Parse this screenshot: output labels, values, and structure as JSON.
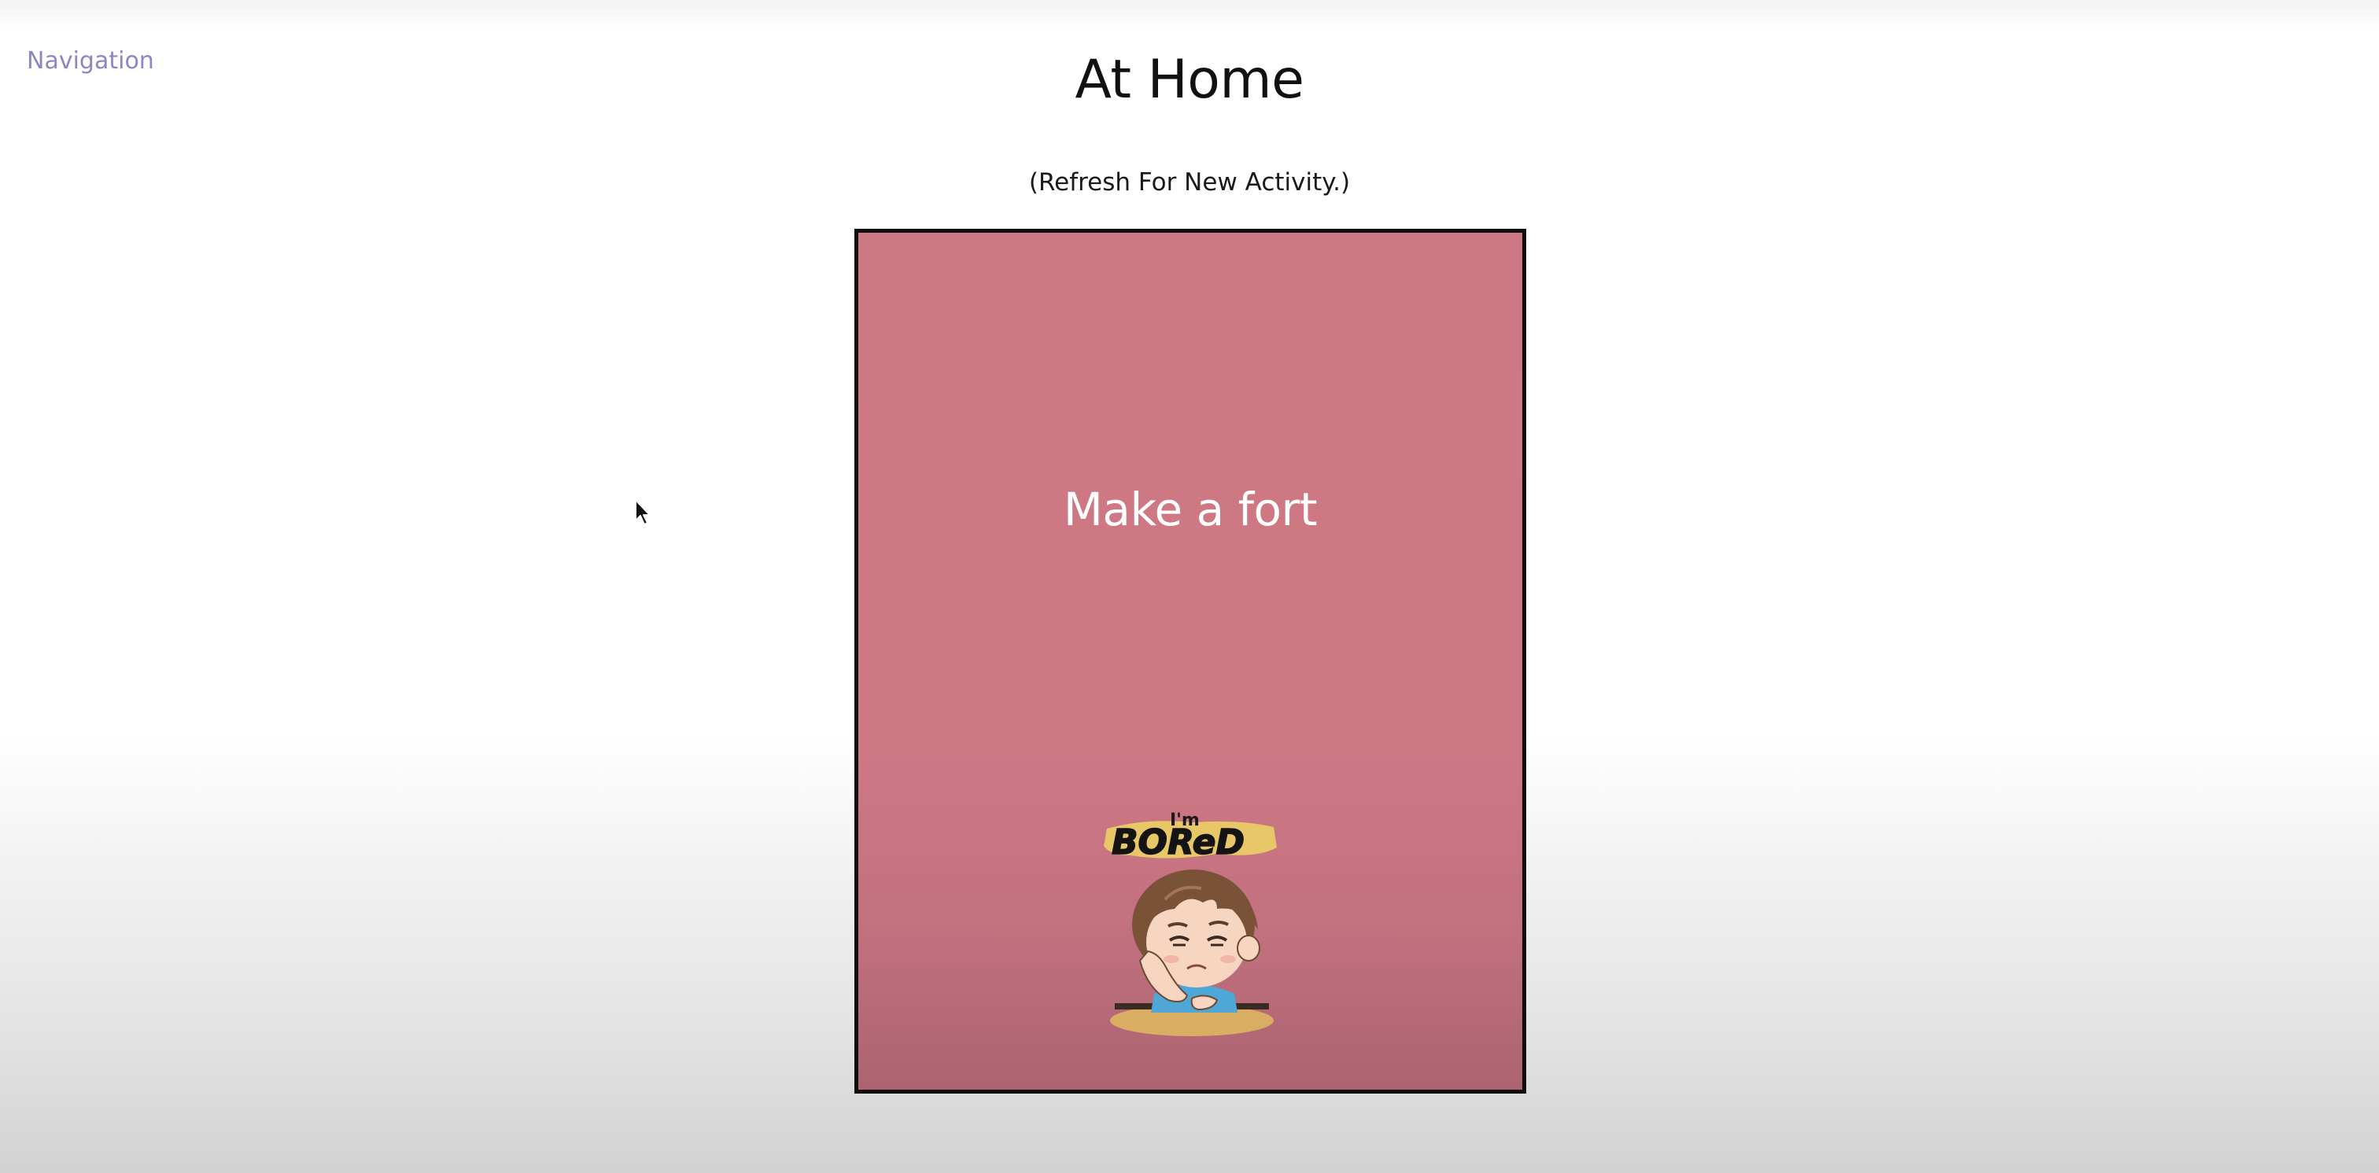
{
  "nav": {
    "label": "Navigation"
  },
  "page": {
    "title": "At Home",
    "subtitle": "(Refresh For New Activity.)"
  },
  "card": {
    "activity": "Make a fort",
    "image": {
      "description_icon": "bored-kid-icon",
      "caption_art": "I'm BOReD"
    }
  },
  "colors": {
    "card_background": "#cd7983",
    "card_border": "#0f0f0f",
    "nav_link": "#8b87c0",
    "activity_text": "#ffffff"
  }
}
